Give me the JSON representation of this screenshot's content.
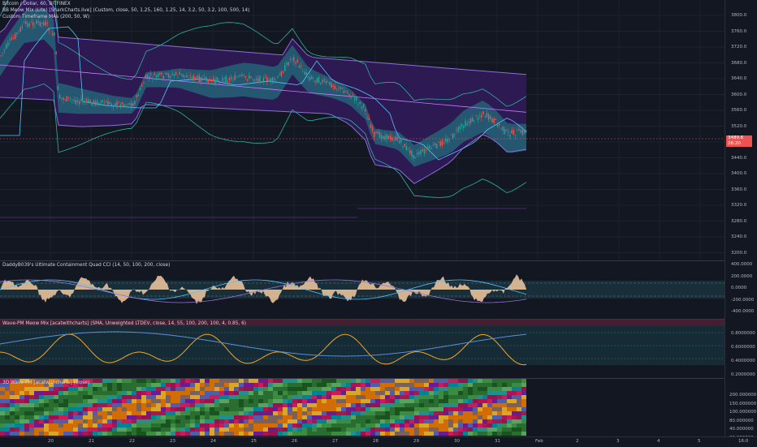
{
  "colors": {
    "background": "#131722",
    "up_candle": "#26a69a",
    "down_candle": "#ef5350",
    "band_fill": "#3b1f6b",
    "teal_fill": "#2a8a8a",
    "cci_fill": "#f5c9a0",
    "wave_line": "#f5a623",
    "wave_blue": "#5b8fd9"
  },
  "main": {
    "title": "Bitcoin / Dollar, 60, BITFINEX",
    "indicator_1": "BB Meow Mix (Lite) [SharkCharts.live] (Custom, close, 50, 1.25, 160, 1.25, 14, 3.2, 50, 3.2, 100, 500, 14)",
    "indicator_2": "Custom Timeframe MAs (200, 50, W)",
    "price_tag": "3489.6",
    "time_tag": "26:20",
    "price_ticks": [
      "3800.0",
      "3760.0",
      "3720.0",
      "3680.0",
      "3640.0",
      "3600.0",
      "3560.0",
      "3520.0",
      "3480.0",
      "3440.0",
      "3400.0",
      "3360.0",
      "3320.0",
      "3280.0",
      "3240.0",
      "3200.0"
    ]
  },
  "cci_pane": {
    "title": "DaddyB039's Ultimate Containment Quad CCI (14, 50, 100, 200, close)",
    "ticks": [
      "400.0000",
      "200.0000",
      "0.0000",
      "-200.0000",
      "-400.0000"
    ]
  },
  "wave_pane": {
    "title": "Wave-PM Meow Mix [acatwithcharts] (SMA, Unweighted LTDEV, close, 14, 55, 100, 200, 100, 4, 0.85, 6)",
    "ticks": [
      "0.8000000",
      "0.6000000",
      "0.4000000",
      "0.2000000"
    ]
  },
  "heat_pane": {
    "title": "3D Wave-PM [acatwithcharts] (close)",
    "ticks": [
      "200.000000",
      "150.000000",
      "100.000000",
      "80.000000",
      "40.000000",
      "20.000000"
    ]
  },
  "time_axis": {
    "labels": [
      "20",
      "21",
      "22",
      "23",
      "24",
      "25",
      "26",
      "27",
      "28",
      "29",
      "30",
      "31",
      "Feb",
      "2",
      "3",
      "4",
      "5",
      "16:0"
    ]
  }
}
